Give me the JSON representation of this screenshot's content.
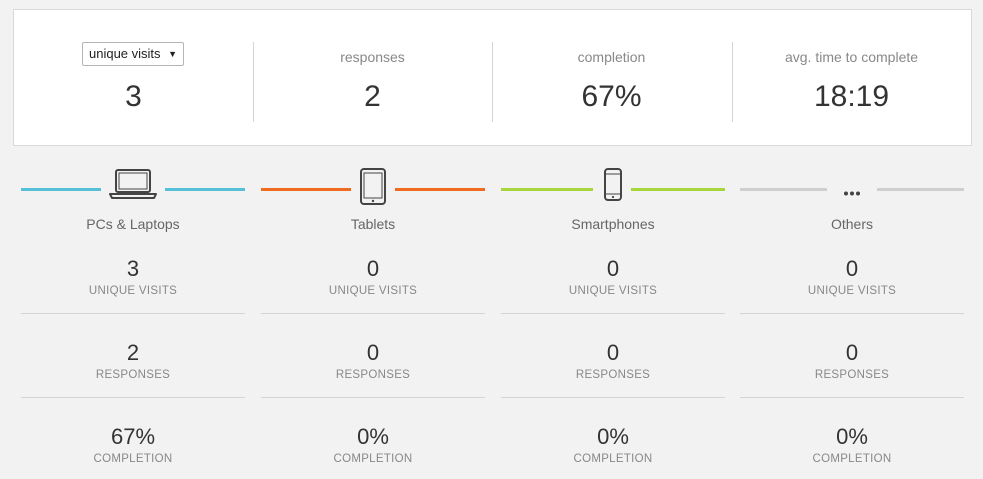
{
  "summary": {
    "selector": {
      "value": "unique visits",
      "visits_value": "3"
    },
    "responses": {
      "label": "responses",
      "value": "2"
    },
    "completion": {
      "label": "completion",
      "value": "67%"
    },
    "avg_time": {
      "label": "avg. time to complete",
      "value": "18:19"
    }
  },
  "devices": [
    {
      "name": "PCs & Laptops",
      "icon": "laptop-icon",
      "color": "#55c0d8",
      "unique_visits": "3",
      "responses": "2",
      "completion": "67%"
    },
    {
      "name": "Tablets",
      "icon": "tablet-icon",
      "color": "#f06b1f",
      "unique_visits": "0",
      "responses": "0",
      "completion": "0%"
    },
    {
      "name": "Smartphones",
      "icon": "smartphone-icon",
      "color": "#a6d63c",
      "unique_visits": "0",
      "responses": "0",
      "completion": "0%"
    },
    {
      "name": "Others",
      "icon": "more-icon",
      "color": "#cfcfcf",
      "unique_visits": "0",
      "responses": "0",
      "completion": "0%"
    }
  ],
  "metric_labels": {
    "unique_visits": "UNIQUE VISITS",
    "responses": "RESPONSES",
    "completion": "COMPLETION"
  }
}
